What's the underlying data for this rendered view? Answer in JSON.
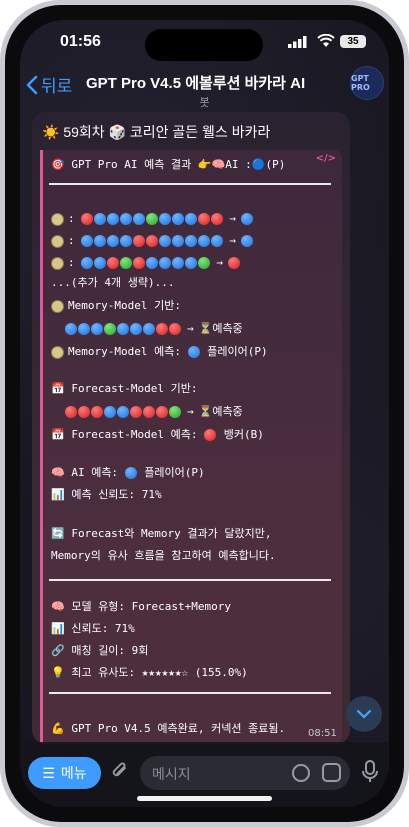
{
  "status": {
    "time": "01:56",
    "battery": "35"
  },
  "header": {
    "back_label": "뒤로",
    "title": "GPT Pro V4.5 에볼루션 바카라 AI",
    "subtitle": "봇",
    "avatar_text": "GPT PRO"
  },
  "message": {
    "head": "☀️ 59회차 🎲 코리안 골든 웰스 바카라",
    "code_tag": "</>",
    "result_line": "🎯 GPT Pro AI 예측 결과 👉🧠AI :🔵(P)",
    "patterns": [
      {
        "dots": [
          "r",
          "b",
          "b",
          "b",
          "b",
          "g",
          "b",
          "b",
          "b",
          "r",
          "r"
        ],
        "next": "b"
      },
      {
        "dots": [
          "b",
          "b",
          "b",
          "b",
          "r",
          "r",
          "b",
          "b",
          "b",
          "b",
          "b"
        ],
        "next": "b"
      },
      {
        "dots": [
          "b",
          "b",
          "r",
          "g",
          "r",
          "b",
          "b",
          "b",
          "b",
          "g"
        ],
        "next": "r"
      }
    ],
    "omitted": "...(추가 4개 생략)...",
    "memory_base_label": "Memory-Model 기반:",
    "memory_dots": [
      "b",
      "b",
      "b",
      "g",
      "b",
      "b",
      "b",
      "r",
      "r"
    ],
    "predicting": "⏳예측중",
    "memory_pred_label": "Memory-Model 예측:",
    "memory_pred_value": "플레이어(P)",
    "forecast_base_label": "Forecast-Model 기반:",
    "forecast_dots": [
      "r",
      "r",
      "r",
      "b",
      "b",
      "r",
      "r",
      "r",
      "g"
    ],
    "forecast_pred_label": "Forecast-Model 예측:",
    "forecast_pred_value": "뱅커(B)",
    "ai_pred_label": "AI 예측:",
    "ai_pred_value": "플레이어(P)",
    "confidence_line": "예측 신뢰도: 71%",
    "note_line1": "Forecast와 Memory 결과가 달랐지만,",
    "note_line2": "Memory의 유사 흐름을 참고하여 예측합니다.",
    "model_type": "모델 유형: Forecast+Memory",
    "reliability": "신뢰도: 71%",
    "match_len": "매칭 길이: 9회",
    "max_similarity": "최고 유사도: ★★★★★★☆ (155.0%)",
    "footer": "GPT Pro V4.5 예측완료, 커넥션 종료됨.",
    "timestamp": "08:51"
  },
  "composer": {
    "menu_label": "메뉴",
    "placeholder": "메시지"
  },
  "colors": {
    "accent": "#3e9bff",
    "quote_bar": "#e0569a",
    "player": "#1b6fe0",
    "banker": "#d6201c",
    "tie": "#26a52a"
  }
}
